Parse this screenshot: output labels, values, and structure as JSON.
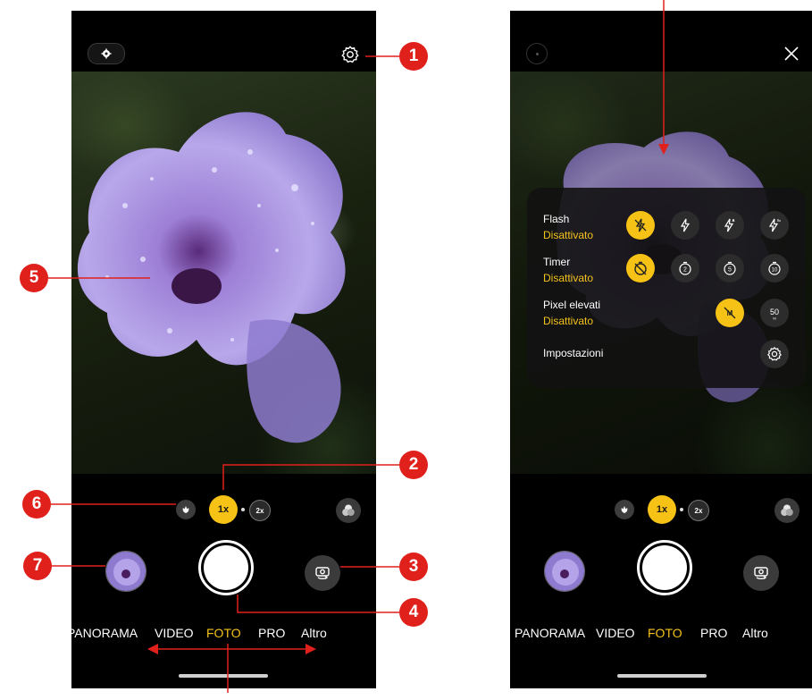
{
  "colors": {
    "accent": "#f5c21b",
    "annotation": "#e0201b"
  },
  "left_phone": {
    "zoom": {
      "macro_icon": "flower-icon",
      "one_x": "1x",
      "two_x": "2x"
    },
    "modes": [
      "PANORAMA",
      "VIDEO",
      "FOTO",
      "PRO",
      "Altro"
    ],
    "active_mode": "FOTO"
  },
  "right_phone": {
    "zoom": {
      "macro_icon": "flower-icon",
      "one_x": "1x",
      "two_x": "2x"
    },
    "modes": [
      "PANORAMA",
      "VIDEO",
      "FOTO",
      "PRO",
      "Altro"
    ],
    "active_mode": "FOTO",
    "quick_settings": {
      "flash": {
        "label": "Flash",
        "value": "Disattivato",
        "options": [
          "flash-off-icon",
          "flash-icon",
          "flash-auto-icon",
          "flash-on-icon"
        ],
        "selected": 0
      },
      "timer": {
        "label": "Timer",
        "value": "Disattivato",
        "options": [
          "timer-off-icon",
          "timer-2-icon",
          "timer-5-icon",
          "timer-10-icon"
        ],
        "selected": 0
      },
      "high_pixels": {
        "label": "Pixel elevati",
        "value": "Disattivato",
        "options": [
          "high-pixels-off-icon",
          "50"
        ],
        "selected": 0
      },
      "settings": {
        "label": "Impostazioni"
      }
    }
  },
  "annotations": [
    "1",
    "2",
    "3",
    "4",
    "5",
    "6",
    "7"
  ]
}
